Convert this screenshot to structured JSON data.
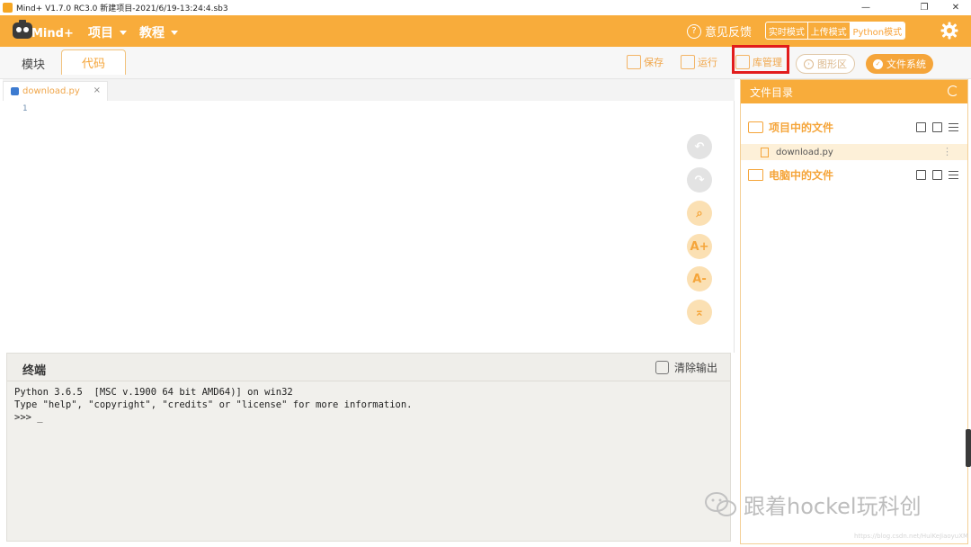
{
  "window": {
    "title": "Mind+ V1.7.0 RC3.0   新建项目-2021/6/19-13:24:4.sb3",
    "controls": [
      "—",
      "❐",
      "✕"
    ]
  },
  "header": {
    "logo_text": "Mind+",
    "menus": [
      {
        "label": "项目"
      },
      {
        "label": "教程"
      }
    ],
    "feedback_label": "意见反馈",
    "modes": [
      {
        "label": "实时模式",
        "active": false
      },
      {
        "label": "上传模式",
        "active": false
      },
      {
        "label": "Python模式",
        "active": true
      }
    ],
    "accent_color": "#f8ac3b"
  },
  "toolbar": {
    "tab_blocks": "模块",
    "tab_code": "代码",
    "save_label": "保存",
    "run_label": "运行",
    "library_label": "库管理",
    "graph_label": "图形区",
    "files_label": "文件系统"
  },
  "editor": {
    "file_tab": "download.py",
    "close": "×",
    "line_numbers": [
      "1"
    ],
    "side_tools": [
      {
        "icon": "undo-icon",
        "glyph": "↶"
      },
      {
        "icon": "redo-icon",
        "glyph": "↷"
      },
      {
        "icon": "search-icon",
        "glyph": "⌕"
      },
      {
        "icon": "font-increase-icon",
        "glyph": "A+"
      },
      {
        "icon": "font-decrease-icon",
        "glyph": "A-"
      },
      {
        "icon": "scroll-top-icon",
        "glyph": "⌅"
      }
    ]
  },
  "terminal": {
    "title": "终端",
    "clear_label": "清除输出",
    "output": "Python 3.6.5  [MSC v.1900 64 bit AMD64)] on win32\nType \"help\", \"copyright\", \"credits\" or \"license\" for more information.\n>>> _"
  },
  "file_panel": {
    "title": "文件目录",
    "project_section": "项目中的文件",
    "project_files": [
      "download.py"
    ],
    "computer_section": "电脑中的文件",
    "more": "⋮"
  },
  "watermark": {
    "text": "跟着hockel玩科创",
    "url": "https://blog.csdn.net/HuiKeJiaoyuXM"
  }
}
